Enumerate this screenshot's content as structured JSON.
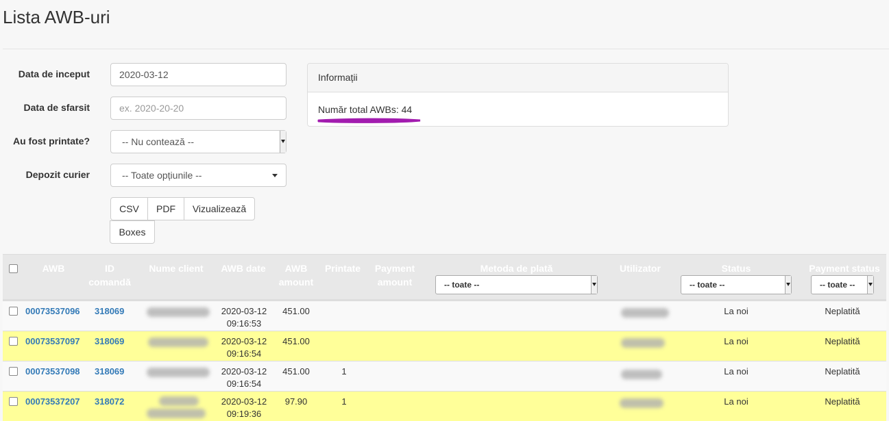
{
  "page": {
    "title": "Lista AWB-uri"
  },
  "form": {
    "start_label": "Data de inceput",
    "start_value": "2020-03-12",
    "end_label": "Data de sfarsit",
    "end_placeholder": "ex. 2020-20-20",
    "printed_label": "Au fost printate?",
    "printed_value": "-- Nu contează --",
    "depot_label": "Depozit curier",
    "depot_value": "-- Toate opțiunile --",
    "buttons": {
      "csv": "CSV",
      "pdf": "PDF",
      "view": "Vizualizează",
      "boxes": "Boxes"
    }
  },
  "info_panel": {
    "heading": "Informații",
    "total_text": "Număr total AWBs: 44",
    "annotation_color": "#a21caf"
  },
  "table": {
    "headers": {
      "awb": "AWB",
      "order_id": "ID comandă",
      "client": "Nume client",
      "awb_date": "AWB date",
      "awb_amount": "AWB amount",
      "printed": "Printate",
      "payment_amount": "Payment amount",
      "payment_method": "Metoda de plată",
      "user": "Utilizator",
      "status": "Status",
      "payment_status": "Payment status"
    },
    "filters": {
      "payment_method": "-- toate --",
      "status": "-- toate --",
      "payment_status": "-- toate --"
    },
    "rows": [
      {
        "awb": "00073537096",
        "order_id": "318069",
        "date": "2020-03-12",
        "time": "09:16:53",
        "amount": "451.00",
        "printed": "",
        "status": "La noi",
        "payment_status": "Neplatită",
        "highlight": false
      },
      {
        "awb": "00073537097",
        "order_id": "318069",
        "date": "2020-03-12",
        "time": "09:16:54",
        "amount": "451.00",
        "printed": "",
        "status": "La noi",
        "payment_status": "Neplatită",
        "highlight": true
      },
      {
        "awb": "00073537098",
        "order_id": "318069",
        "date": "2020-03-12",
        "time": "09:16:54",
        "amount": "451.00",
        "printed": "1",
        "status": "La noi",
        "payment_status": "Neplatită",
        "highlight": false
      },
      {
        "awb": "00073537207",
        "order_id": "318072",
        "date": "2020-03-12",
        "time": "09:19:36",
        "amount": "97.90",
        "printed": "1",
        "status": "La noi",
        "payment_status": "Neplatită",
        "highlight": true
      }
    ]
  },
  "colors": {
    "link": "#337ab7",
    "highlight_row": "#ffff99",
    "header_bg": "#e8e8e8"
  }
}
